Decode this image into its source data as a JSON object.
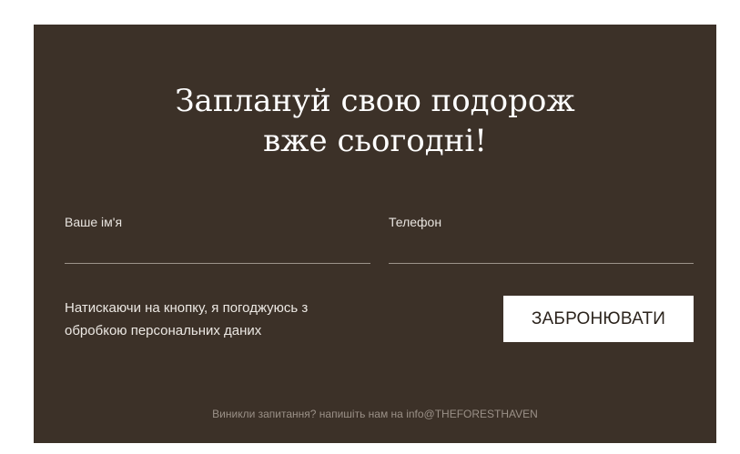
{
  "heading": {
    "line1": "Заплануй свою подорож",
    "line2": "вже сьогодні!"
  },
  "form": {
    "name_label": "Ваше ім'я",
    "name_value": "",
    "phone_label": "Телефон",
    "phone_value": "",
    "consent_line1": "Натискаючи на кнопку, я погоджуюсь з",
    "consent_line2": "обробкою персональних даних",
    "submit_label": "ЗАБРОНЮВАТИ"
  },
  "footer": {
    "prefix": "Виникли запитання? напишіть нам на ",
    "contact": "info@THEFORESTHAVEN"
  },
  "colors": {
    "panel_background": "#3c3128",
    "button_background": "#ffffff",
    "text": "#ffffff"
  }
}
